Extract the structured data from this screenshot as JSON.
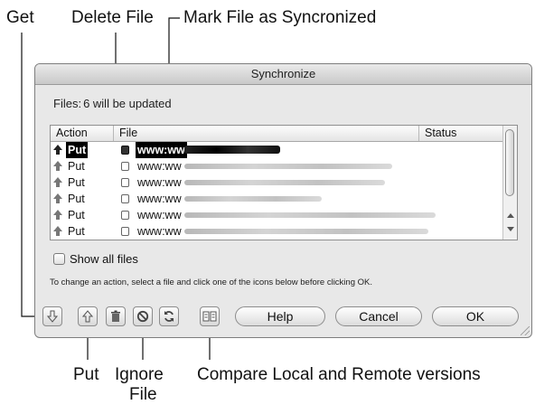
{
  "callouts": {
    "get": "Get",
    "delete_file": "Delete File",
    "mark_synced": "Mark File as Syncronized",
    "put": "Put",
    "ignore_file_line1": "Ignore",
    "ignore_file_line2": "File",
    "compare": "Compare Local and Remote versions"
  },
  "dialog": {
    "title": "Synchronize",
    "files_label": "Files:",
    "files_count": "6 will be updated",
    "columns": [
      "Action",
      "File",
      "Status"
    ],
    "rows": [
      {
        "action": "Put",
        "file": "www:ww",
        "selected": true
      },
      {
        "action": "Put",
        "file": "www:ww",
        "selected": false
      },
      {
        "action": "Put",
        "file": "www:ww",
        "selected": false
      },
      {
        "action": "Put",
        "file": "www:ww",
        "selected": false
      },
      {
        "action": "Put",
        "file": "www:ww",
        "selected": false
      },
      {
        "action": "Put",
        "file": "www:ww",
        "selected": false
      }
    ],
    "show_all_label": "Show all files",
    "hint": "To change an action, select a file and click one of the icons below before clicking OK.",
    "buttons": {
      "help": "Help",
      "cancel": "Cancel",
      "ok": "OK"
    },
    "icons": [
      "get-icon",
      "put-icon",
      "trash-icon",
      "ignore-icon",
      "sync-icon",
      "compare-icon"
    ]
  }
}
